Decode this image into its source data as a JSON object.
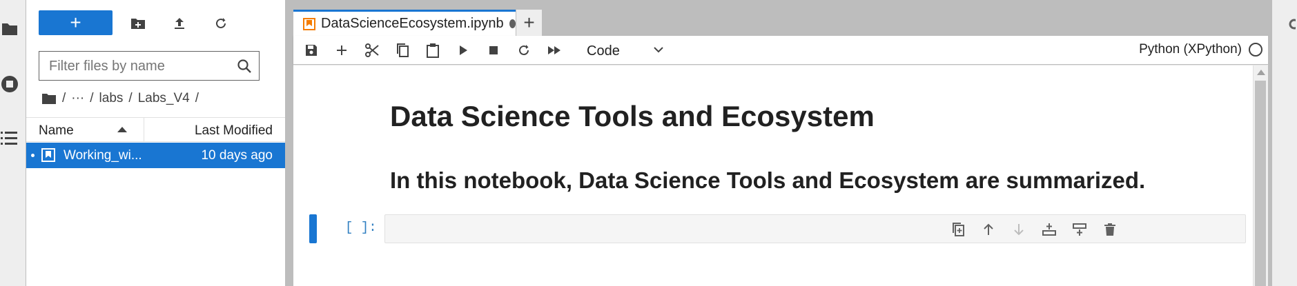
{
  "file_browser": {
    "new_label": "+",
    "filter_placeholder": "Filter files by name",
    "breadcrumbs": [
      "/",
      "···",
      "/",
      "labs",
      "/",
      "Labs_V4",
      "/"
    ],
    "columns": {
      "name": "Name",
      "modified": "Last Modified"
    },
    "files": [
      {
        "name": "Working_wi...",
        "modified": "10 days ago",
        "selected": true
      }
    ]
  },
  "tabs": {
    "active_label": "DataScienceEcosystem.ipynb",
    "add_label": "+"
  },
  "toolbar": {
    "cell_type": "Code",
    "kernel": "Python (XPython)"
  },
  "notebook": {
    "heading1": "Data Science Tools and Ecosystem",
    "heading2": "In this notebook, Data Science Tools and Ecosystem are summarized.",
    "cell_prompt": "[ ]:"
  },
  "colors": {
    "accent": "#1976d2",
    "notebook_icon": "#f57c00",
    "prompt": "#307fc1"
  }
}
